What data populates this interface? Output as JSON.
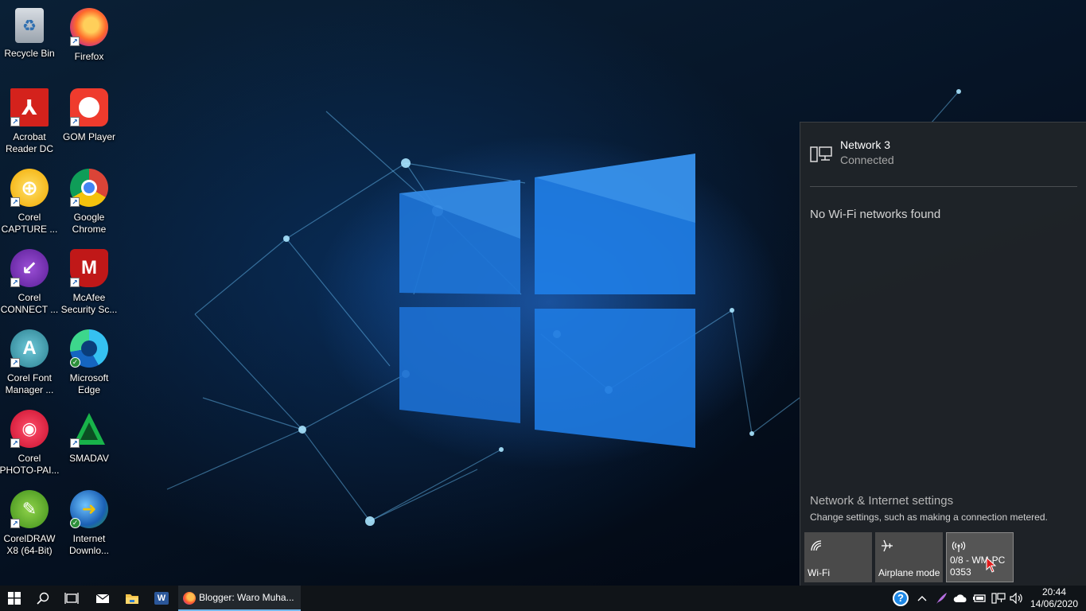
{
  "desktop": {
    "icons": [
      {
        "label": "Recycle Bin",
        "icon": "recycle-bin-icon"
      },
      {
        "label": "Firefox",
        "icon": "firefox-icon"
      },
      {
        "label": "Acrobat Reader DC",
        "icon": "acrobat-icon"
      },
      {
        "label": "GOM Player",
        "icon": "gom-player-icon"
      },
      {
        "label": "Corel CAPTURE ...",
        "icon": "corel-capture-icon"
      },
      {
        "label": "Google Chrome",
        "icon": "chrome-icon"
      },
      {
        "label": "Corel CONNECT ...",
        "icon": "corel-connect-icon"
      },
      {
        "label": "McAfee Security Sc...",
        "icon": "mcafee-icon"
      },
      {
        "label": "Corel Font Manager ...",
        "icon": "corel-font-manager-icon"
      },
      {
        "label": "Microsoft Edge",
        "icon": "edge-icon"
      },
      {
        "label": "Corel PHOTO-PAI...",
        "icon": "corel-photo-paint-icon"
      },
      {
        "label": "SMADAV",
        "icon": "smadav-icon"
      },
      {
        "label": "CorelDRAW X8 (64-Bit)",
        "icon": "coreldraw-icon"
      },
      {
        "label": "Internet Downlo...",
        "icon": "internet-download-manager-icon"
      }
    ]
  },
  "flyout": {
    "network_name": "Network 3",
    "network_status": "Connected",
    "no_wifi_text": "No Wi-Fi networks found",
    "settings_link": "Network & Internet settings",
    "settings_sub": "Change settings, such as making a connection metered.",
    "tiles": [
      {
        "label": "Wi-Fi",
        "icon": "wifi-icon"
      },
      {
        "label": "Airplane mode",
        "icon": "airplane-icon"
      },
      {
        "label": "0/8 - WM-PC 0353",
        "icon": "mobile-hotspot-icon"
      }
    ]
  },
  "taskbar": {
    "task_label": "Blogger: Waro Muha...",
    "clock_time": "20:44",
    "clock_date": "14/06/2020"
  },
  "colors": {
    "taskbar_bg": "#101418",
    "flyout_bg": "#202428",
    "tile_bg": "#4a4a4a",
    "accent": "#76b9ed"
  }
}
